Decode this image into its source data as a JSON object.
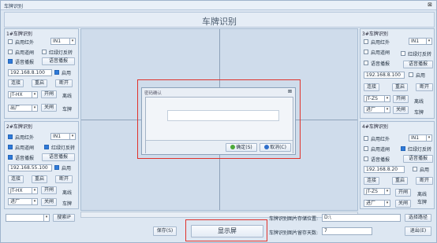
{
  "window": {
    "title": "车牌识别",
    "close": "⊠"
  },
  "header": {
    "title": "车牌识别"
  },
  "cam1": {
    "title": "1#车牌识别",
    "ir": "启用红外",
    "ir_on": false,
    "ir_sel": "IN1",
    "gate": "启用道闸",
    "gate_on": false,
    "redgreen": "红绿灯反转",
    "redgreen_on": false,
    "voice": "语音播报",
    "voice_on": true,
    "voice_btn": "语音播报",
    "ip": "192.168.8.100",
    "enable": "启用",
    "enable_on": true,
    "connect": "连接",
    "restart": "重启",
    "disconnect": "断开",
    "model": "JT-HX",
    "open": "开闸",
    "offline": "离线",
    "direction": "出厂",
    "close": "关闸",
    "plate": "车牌"
  },
  "cam2": {
    "title": "2#车牌识别",
    "ir": "启用红外",
    "ir_on": true,
    "ir_sel": "IN1",
    "gate": "启用道闸",
    "gate_on": true,
    "redgreen": "红绿灯反转",
    "redgreen_on": true,
    "voice": "语音播报",
    "voice_on": true,
    "voice_btn": "语音播报",
    "ip": "192.168.55.100",
    "enable": "启用",
    "enable_on": true,
    "connect": "连接",
    "restart": "重启",
    "disconnect": "断开",
    "model": "JT-HX",
    "open": "开闸",
    "offline": "离线",
    "direction": "进厂",
    "close": "关闸",
    "plate": "车牌"
  },
  "cam3": {
    "title": "3#车牌识别",
    "ir": "启用红外",
    "ir_on": false,
    "ir_sel": "IN1",
    "gate": "启用道闸",
    "gate_on": false,
    "redgreen": "红绿灯反转",
    "redgreen_on": false,
    "voice": "语音播报",
    "voice_on": false,
    "voice_btn": "语音播报",
    "ip": "192.168.8.100",
    "enable": "启用",
    "enable_on": false,
    "connect": "连接",
    "restart": "重启",
    "disconnect": "断开",
    "model": "JT-ZS",
    "open": "开闸",
    "offline": "离线",
    "direction": "进厂",
    "close": "关闸",
    "plate": "车牌"
  },
  "cam4": {
    "title": "4#车牌识别",
    "ir": "启用红外",
    "ir_on": false,
    "ir_sel": "IN1",
    "gate": "启用道闸",
    "gate_on": false,
    "redgreen": "红绿灯反转",
    "redgreen_on": true,
    "voice": "语音播报",
    "voice_on": false,
    "voice_btn": "语音播报",
    "ip": "192.168.8.20",
    "enable": "启用",
    "enable_on": false,
    "connect": "连接",
    "restart": "重启",
    "disconnect": "断开",
    "model": "JT-ZS",
    "open": "开闸",
    "offline": "离线",
    "direction": "进厂",
    "close": "关闸",
    "plate": "车牌"
  },
  "bottom": {
    "search": "搜索IP",
    "save": "保存(S)",
    "show_screen": "显示屏",
    "path_label": "车牌识别图片存储位置:",
    "path_value": "D:\\",
    "choose_path": "选择路径",
    "days_label": "车牌识别图片留存天数:",
    "days_value": "7",
    "exit": "退出(E)"
  },
  "dialog": {
    "title": "密码确认",
    "close": "⊠",
    "ok": "确定(S)",
    "cancel": "取消(C)"
  }
}
